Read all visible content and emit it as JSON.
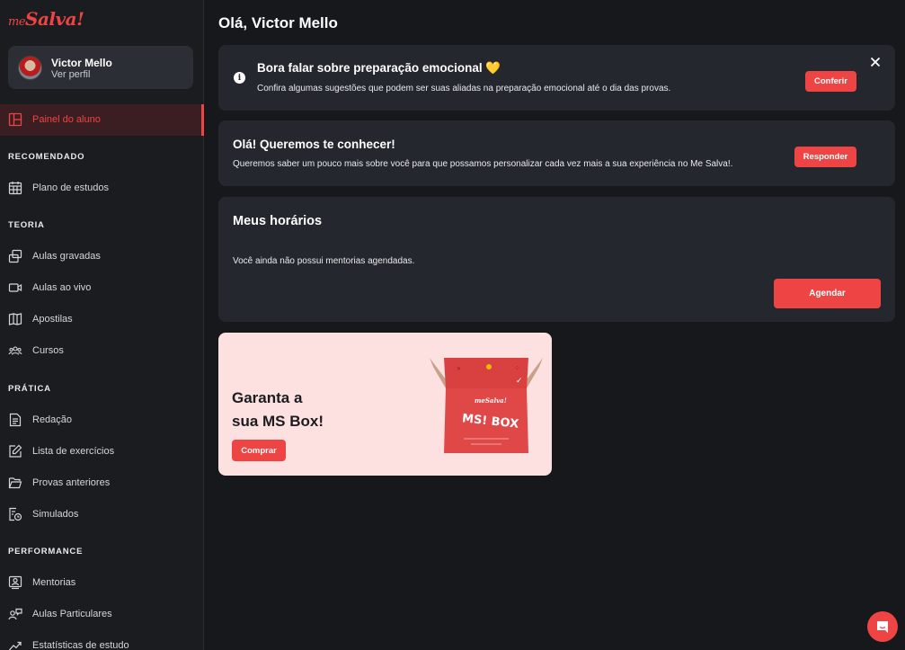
{
  "brand": {
    "logo_me": "me",
    "logo_salva": "Salva!",
    "accent": "#ef4444"
  },
  "profile": {
    "name": "Victor Mello",
    "link": "Ver perfil"
  },
  "sidebar": {
    "active_item": {
      "label": "Painel do aluno",
      "icon": "dashboard-icon"
    },
    "sections": [
      {
        "title": "RECOMENDADO",
        "items": [
          {
            "label": "Plano de estudos",
            "icon": "calendar-icon"
          }
        ]
      },
      {
        "title": "TEORIA",
        "items": [
          {
            "label": "Aulas gravadas",
            "icon": "recorded-lessons-icon"
          },
          {
            "label": "Aulas ao vivo",
            "icon": "video-camera-icon"
          },
          {
            "label": "Apostilas",
            "icon": "book-icon"
          },
          {
            "label": "Cursos",
            "icon": "people-icon"
          }
        ]
      },
      {
        "title": "PRÁTICA",
        "items": [
          {
            "label": "Redação",
            "icon": "document-icon"
          },
          {
            "label": "Lista de exercícios",
            "icon": "edit-icon"
          },
          {
            "label": "Provas anteriores",
            "icon": "folder-icon"
          },
          {
            "label": "Simulados",
            "icon": "exam-clock-icon"
          }
        ]
      },
      {
        "title": "PERFORMANCE",
        "items": [
          {
            "label": "Mentorias",
            "icon": "mentor-icon"
          },
          {
            "label": "Aulas Particulares",
            "icon": "private-lesson-icon"
          },
          {
            "label": "Estatísticas de estudo",
            "icon": "chart-line-icon"
          }
        ]
      }
    ]
  },
  "main": {
    "greeting": "Olá, Victor Mello",
    "emotional_card": {
      "title": "Bora falar sobre preparação emocional 💛",
      "text": "Confira algumas sugestões que podem ser suas aliadas na preparação emocional até o dia das provas.",
      "button": "Conferir"
    },
    "survey_card": {
      "title": "Olá! Queremos te conhecer!",
      "text": "Queremos saber um pouco mais sobre você para que possamos personalizar cada vez mais a sua experiência no Me Salva!.",
      "button": "Responder"
    },
    "schedule_card": {
      "title": "Meus horários",
      "text": "Você ainda não possui mentorias agendadas.",
      "button": "Agendar"
    },
    "promo": {
      "title_line1": "Garanta a",
      "title_line2": "sua MS Box!",
      "button": "Comprar",
      "box_label": "MS! BOX",
      "box_logo": "meSalva!"
    }
  },
  "chat": {
    "icon": "chat-icon"
  }
}
